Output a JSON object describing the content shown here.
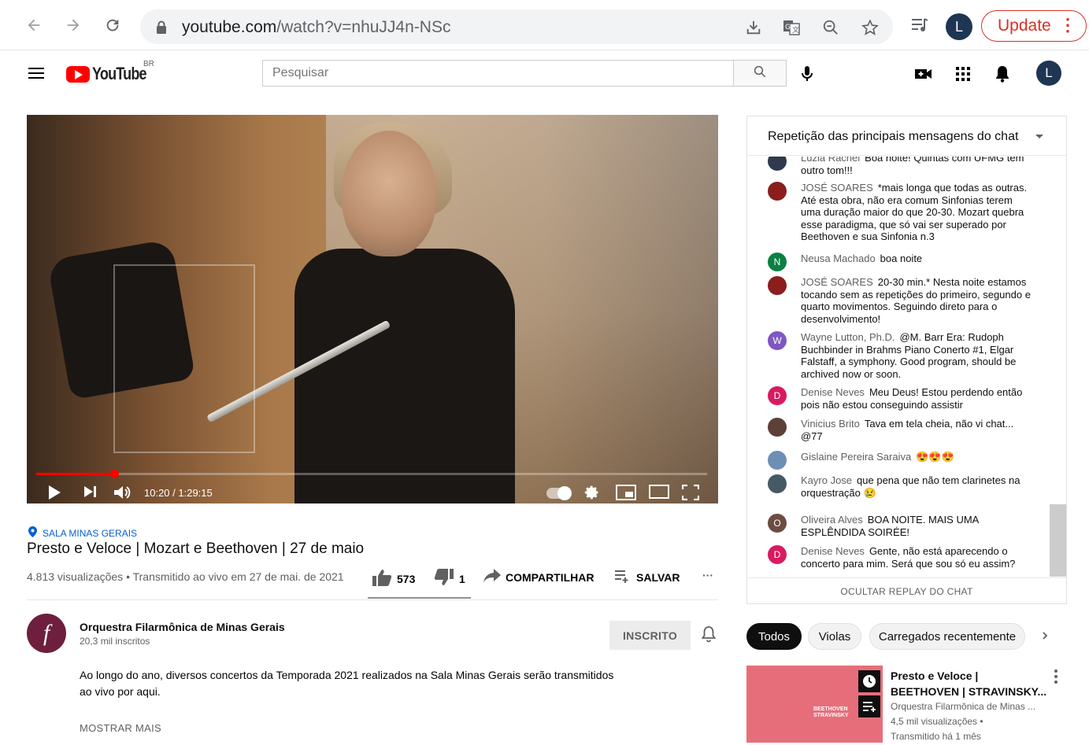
{
  "browser": {
    "url_host": "youtube.com",
    "url_path": "/watch?v=nhuJJ4n-NSc",
    "profile_initial": "L",
    "update_label": "Update",
    "menu_dots": "⋮"
  },
  "header": {
    "logo_text": "YouTube",
    "country_code": "BR",
    "search_placeholder": "Pesquisar",
    "avatar_initial": "L"
  },
  "player": {
    "time": "10:20 / 1:29:15",
    "progress_fraction": 0.116
  },
  "video": {
    "location": "SALA MINAS GERAIS",
    "title": "Presto e Veloce | Mozart e Beethoven | 27 de maio",
    "meta": "4.813 visualizações • Transmitido ao vivo em 27 de mai. de 2021",
    "likes": "573",
    "dislikes": "1",
    "share_label": "COMPARTILHAR",
    "save_label": "SALVAR",
    "more_label": "···"
  },
  "channel": {
    "name": "Orquestra Filarmônica de Minas Gerais",
    "subscribers": "20,3 mil inscritos",
    "avatar_letter": "f",
    "subscribed_label": "INSCRITO",
    "description": "Ao longo do ano, diversos concertos da Temporada 2021 realizados na Sala Minas Gerais serão transmitidos ao vivo por aqui.",
    "show_more": "MOSTRAR MAIS"
  },
  "chat": {
    "header": "Repetição das principais mensagens do chat",
    "hide_label": "OCULTAR REPLAY DO CHAT",
    "messages": [
      {
        "author": "Luzia Rachel",
        "text": "Boa noite! Quintas com UFMG tem outro tom!!!",
        "initial": "",
        "color": "#2f3b4d"
      },
      {
        "author": "JOSÉ SOARES",
        "text": "*mais longa que todas as outras. Até esta obra, não era comum Sinfonias terem uma duração maior do que 20-30. Mozart quebra esse paradigma, que só vai ser superado por Beethoven e sua Sinfonia n.3",
        "initial": "",
        "color": "#8b1d1d"
      },
      {
        "author": "Neusa Machado",
        "text": "boa noite",
        "initial": "N",
        "color": "#0b8043"
      },
      {
        "author": "JOSÉ SOARES",
        "text": "20-30 min.* Nesta noite estamos tocando sem as repetições do primeiro, segundo e quarto movimentos. Seguindo direto para o desenvolvimento!",
        "initial": "",
        "color": "#8b1d1d"
      },
      {
        "author": "Wayne Lutton, Ph.D.",
        "text": "@M. Barr Era: Rudoph Buchbinder in Brahms Piano Conerto #1, Elgar Falstaff, a symphony. Good program, should be archived now or soon.",
        "initial": "W",
        "color": "#7e57c2"
      },
      {
        "author": "Denise Neves",
        "text": "Meu Deus! Estou perdendo então pois não estou conseguindo assistir",
        "initial": "D",
        "color": "#d81b60"
      },
      {
        "author": "Vinicius Brito",
        "text": "Tava em tela cheia, não vi chat... @77",
        "initial": "",
        "color": "#5d4037"
      },
      {
        "author": "Gislaine Pereira Saraiva",
        "text": "😍😍😍",
        "initial": "",
        "color": "#6d8fb3"
      },
      {
        "author": "Kayro Jose",
        "text": "que pena que não tem clarinetes na orquestração 😢",
        "initial": "",
        "color": "#455a64"
      },
      {
        "author": "Oliveira Alves",
        "text": "BOA NOITE. MAIS UMA ESPLÊNDIDA SOIRÉE!",
        "initial": "O",
        "color": "#6d4c41"
      },
      {
        "author": "Denise Neves",
        "text": "Gente, não está aparecendo o concerto para mim. Será que sou só eu assim?",
        "initial": "D",
        "color": "#d81b60"
      }
    ]
  },
  "chips": [
    "Todos",
    "Violas",
    "Carregados recentemente"
  ],
  "recommended": {
    "title": "Presto e Veloce | BEETHOVEN | STRAVINSKY...",
    "channel": "Orquestra Filarmônica de Minas ...",
    "views": "4,5 mil visualizações •",
    "age": "Transmitido há 1 mês",
    "thumb_text_1": "BEETHOVEN",
    "thumb_text_2": "STRAVINSKY"
  },
  "colors": {
    "brand_red": "#ff0000",
    "link_blue": "#065fd4",
    "update_red": "#d93025"
  }
}
